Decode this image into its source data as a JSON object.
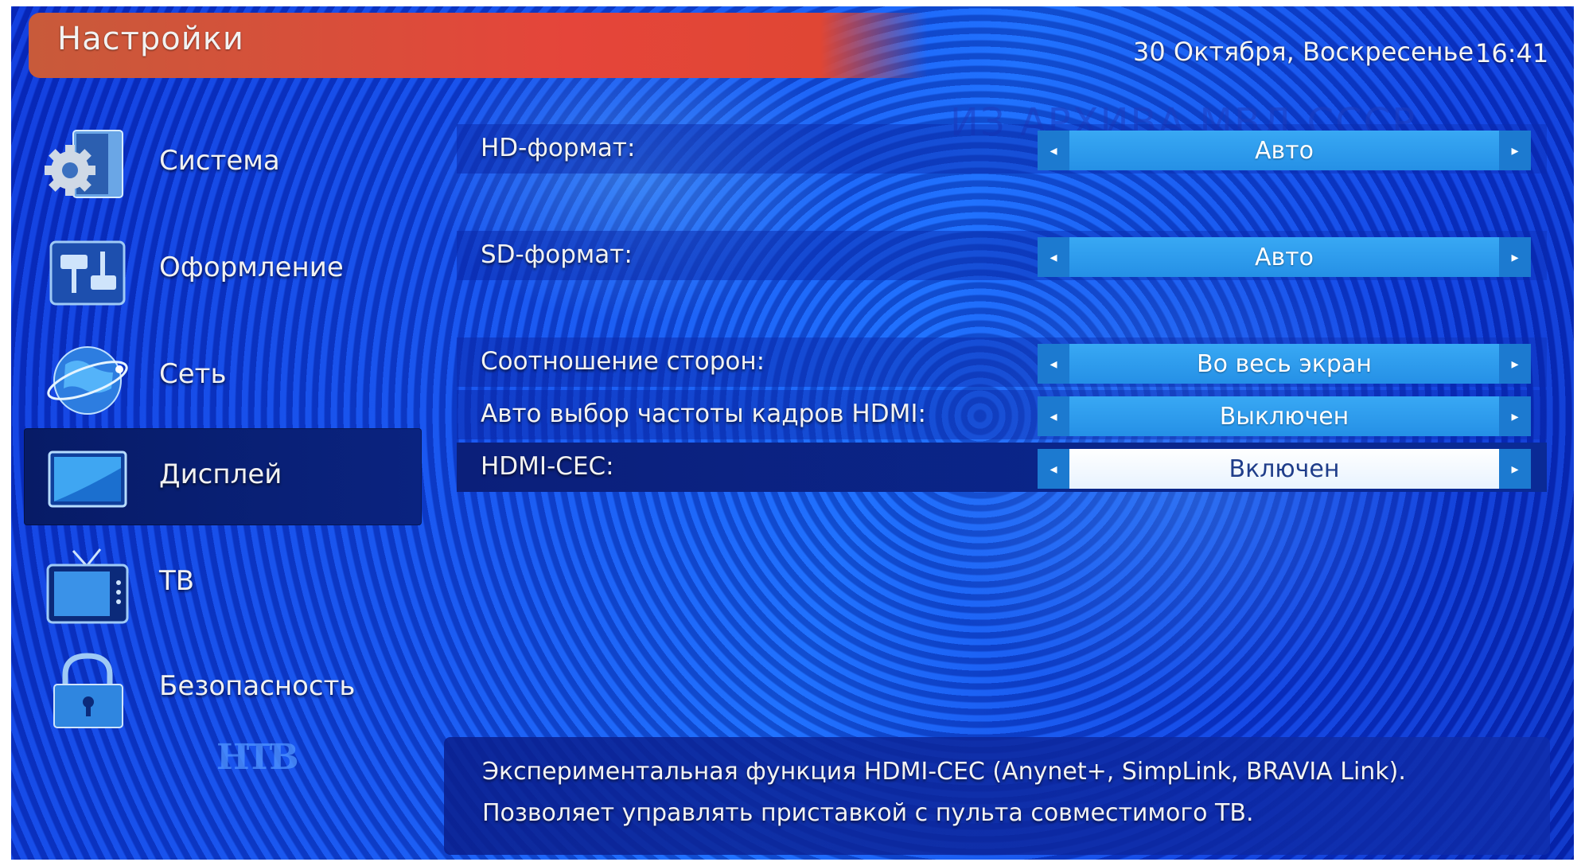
{
  "header": {
    "title": "Настройки",
    "date": "30 Октября, Воскресенье",
    "time": "16:41",
    "watermark": "ИЗ АРХИВА МВД СССР"
  },
  "sidebar": {
    "items": [
      {
        "label": "Система",
        "icon": "gear-icon"
      },
      {
        "label": "Оформление",
        "icon": "sliders-icon"
      },
      {
        "label": "Сеть",
        "icon": "globe-icon"
      },
      {
        "label": "Дисплей",
        "icon": "display-icon"
      },
      {
        "label": "ТВ",
        "icon": "tv-icon"
      },
      {
        "label": "Безопасность",
        "icon": "lock-icon"
      }
    ],
    "active_index": 3
  },
  "settings": [
    {
      "label": "HD-формат:",
      "value": "Авто"
    },
    {
      "label": "SD-формат:",
      "value": "Авто"
    },
    {
      "label": "Соотношение сторон:",
      "value": "Во весь экран"
    },
    {
      "label": "Авто выбор частоты кадров HDMI:",
      "value": "Выключен"
    },
    {
      "label": "HDMI-CEC:",
      "value": "Включен"
    }
  ],
  "controls": {
    "left_arrow": "◂",
    "right_arrow": "▸"
  },
  "logo": {
    "text": "НТВ"
  },
  "help": {
    "line1": "Экспериментальная функция HDMI-CEC (Anynet+, SimpLink, BRAVIA Link).",
    "line2": "Позволяет управлять приставкой с пульта совместимого ТВ."
  },
  "colors": {
    "accent": "#e5453a",
    "selected_value_bg": "#ffffff",
    "value_bg": "#2f9cf0"
  }
}
